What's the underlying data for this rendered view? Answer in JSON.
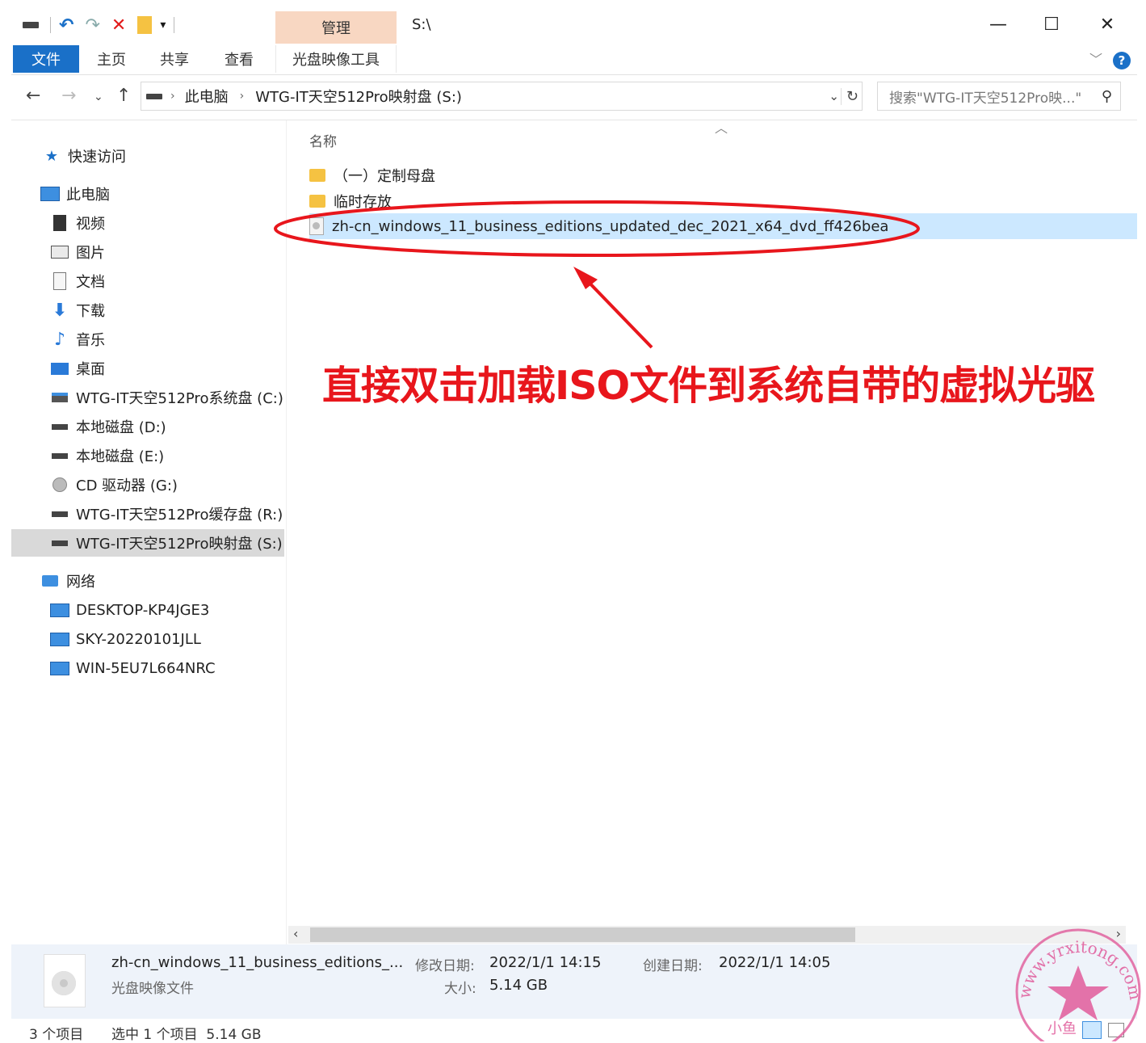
{
  "titlebar": {
    "manage_tab": "管理",
    "path_title": "S:\\",
    "minimize": "—",
    "maximize": "☐",
    "close": "✕"
  },
  "ribbon": {
    "tabs": [
      "文件",
      "主页",
      "共享",
      "查看"
    ],
    "tool_tab": "光盘映像工具",
    "help": "?"
  },
  "address": {
    "crumbs": [
      "此电脑",
      "WTG-IT天空512Pro映射盘 (S:)"
    ],
    "search_placeholder": "搜索\"WTG-IT天空512Pro映...\""
  },
  "sidebar": {
    "quick_access": "快速访问",
    "this_pc": "此电脑",
    "pc_items": [
      "视频",
      "图片",
      "文档",
      "下载",
      "音乐",
      "桌面",
      "WTG-IT天空512Pro系统盘 (C:)",
      "本地磁盘 (D:)",
      "本地磁盘 (E:)",
      "CD 驱动器 (G:)",
      "WTG-IT天空512Pro缓存盘 (R:)",
      "WTG-IT天空512Pro映射盘 (S:)"
    ],
    "network": "网络",
    "network_items": [
      "DESKTOP-KP4JGE3",
      "SKY-20220101JLL",
      "WIN-5EU7L664NRC"
    ]
  },
  "filelist": {
    "column_name": "名称",
    "files": [
      "（一）定制母盘",
      "临时存放",
      "zh-cn_windows_11_business_editions_updated_dec_2021_x64_dvd_ff426bea"
    ]
  },
  "annotation": {
    "text": "直接双击加载ISO文件到系统自带的虚拟光驱",
    "color": "#e8161c"
  },
  "details": {
    "filename": "zh-cn_windows_11_business_editions_...",
    "type": "光盘映像文件",
    "modified_label": "修改日期:",
    "modified_value": "2022/1/1 14:15",
    "created_label": "创建日期:",
    "created_value": "2022/1/1 14:05",
    "size_label": "大小:",
    "size_value": "5.14 GB"
  },
  "status": {
    "count": "3 个项目",
    "selected": "选中 1 个项目  5.14 GB"
  },
  "watermark": {
    "url": "www.yrxitong.com",
    "name": "小鱼"
  },
  "colors": {
    "accent": "#1a70c8",
    "selection": "#cce8ff",
    "manage_tab": "#f8d7c2"
  }
}
